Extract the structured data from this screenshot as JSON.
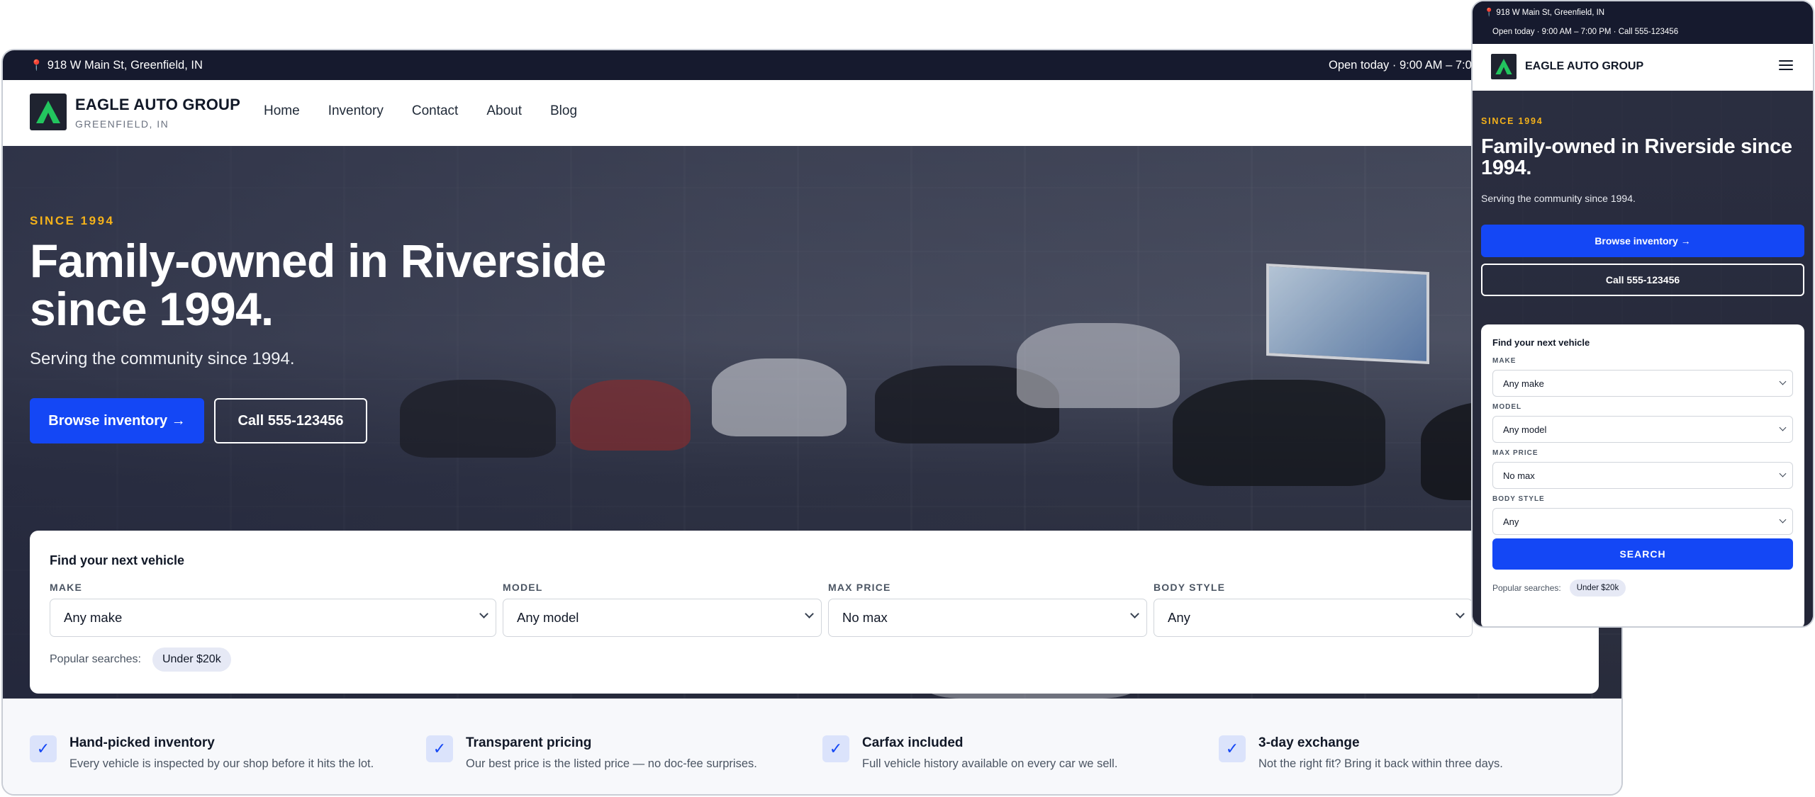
{
  "address": "918 W Main St, Greenfield, IN",
  "hours": "Open today · 9:00 AM – 7:00 PM",
  "mobile_topbar_hours": "Open today · 9:00 AM – 7:00 PM · Call 555-123456",
  "brand": {
    "name": "EAGLE AUTO GROUP",
    "location": "GREENFIELD, IN"
  },
  "nav": {
    "items": [
      "Home",
      "Inventory",
      "Contact",
      "About",
      "Blog"
    ]
  },
  "hero": {
    "eyebrow": "SINCE 1994",
    "title": "Family-owned in Riverside since 1994.",
    "subtitle": "Serving the community since 1994.",
    "primary_cta": "Browse inventory →",
    "secondary_cta": "Call 555-123456"
  },
  "search": {
    "title": "Find your next vehicle",
    "fields": [
      {
        "label": "MAKE",
        "value": "Any make"
      },
      {
        "label": "MODEL",
        "value": "Any model"
      },
      {
        "label": "MAX PRICE",
        "value": "No max"
      },
      {
        "label": "BODY STYLE",
        "value": "Any"
      }
    ],
    "button": "SEARCH",
    "popular_label": "Popular searches:",
    "popular_chips": [
      "Under $20k"
    ]
  },
  "features": [
    {
      "title": "Hand-picked inventory",
      "desc": "Every vehicle is inspected by our shop before it hits the lot."
    },
    {
      "title": "Transparent pricing",
      "desc": "Our best price is the listed price — no doc-fee surprises."
    },
    {
      "title": "Carfax included",
      "desc": "Full vehicle history available on every car we sell."
    },
    {
      "title": "3-day exchange",
      "desc": "Not the right fit? Bring it back within three days."
    }
  ],
  "colors": {
    "accent": "#1447f5",
    "topbar": "#161a2e",
    "eyebrow": "#f5b21a",
    "logo_green": "#22c55e"
  },
  "icons": {
    "pin": "map-pin-icon",
    "menu": "hamburger-menu-icon",
    "check": "check-icon",
    "chevron": "chevron-down-icon"
  }
}
